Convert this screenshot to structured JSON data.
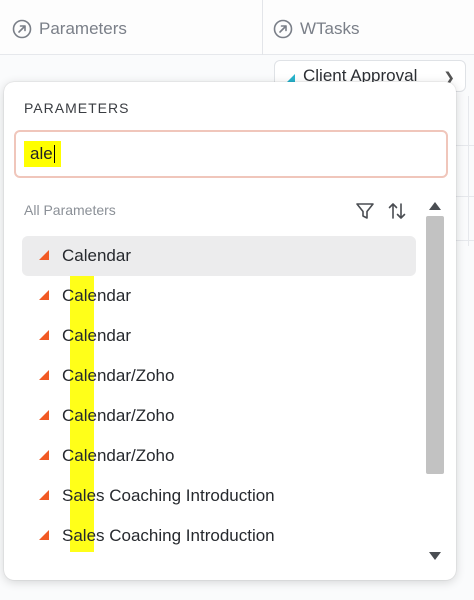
{
  "background": {
    "columns": [
      {
        "label": "Parameters"
      },
      {
        "label": "WTasks"
      }
    ],
    "chip": {
      "label": "Client Approval"
    }
  },
  "popup": {
    "title": "PARAMETERS",
    "search": {
      "value": "ale",
      "highlight_color": "#ffff00"
    },
    "list_header": "All Parameters",
    "items": [
      {
        "label": "Calendar",
        "selected": true
      },
      {
        "label": "Calendar",
        "selected": false
      },
      {
        "label": "Calendar",
        "selected": false
      },
      {
        "label": "Calendar/Zoho",
        "selected": false
      },
      {
        "label": "Calendar/Zoho",
        "selected": false
      },
      {
        "label": "Calendar/Zoho",
        "selected": false
      },
      {
        "label": "Sales Coaching Introduction",
        "selected": false
      },
      {
        "label": "Sales Coaching Introduction",
        "selected": false
      }
    ],
    "item_icon": "orange-triangle-icon",
    "icons": {
      "filter": "filter-icon",
      "sort": "sort-icon"
    }
  },
  "colors": {
    "accent_orange": "#f15a24",
    "chip_teal": "#27b3cc",
    "search_border": "#f0c6bb",
    "selected_row": "#ececed"
  }
}
